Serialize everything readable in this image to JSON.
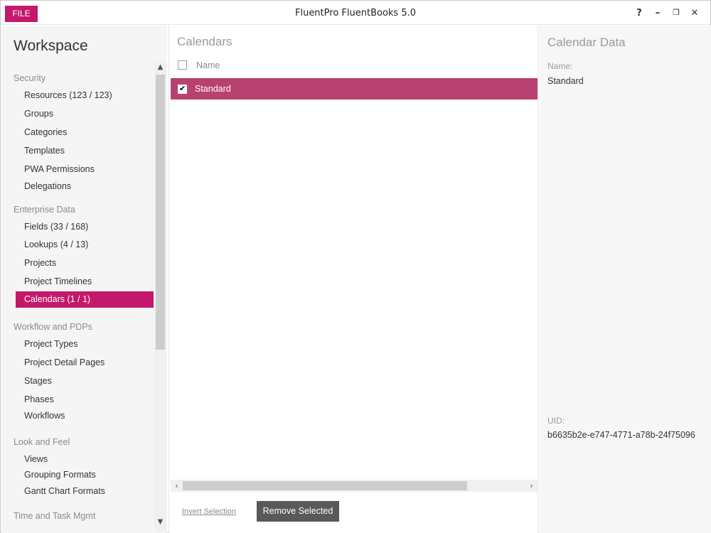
{
  "titlebar": {
    "file_label": "FILE",
    "title": "FluentPro FluentBooks 5.0",
    "help": "?",
    "minimize": "–",
    "restore": "❐",
    "close": "✕"
  },
  "sidebar": {
    "title": "Workspace",
    "sections": [
      {
        "label": "Security",
        "items": [
          "Resources (123 / 123)",
          "Groups",
          "Categories",
          "Templates",
          "PWA Permissions",
          "Delegations"
        ]
      },
      {
        "label": "Enterprise Data",
        "items": [
          "Fields (33 / 168)",
          "Lookups (4 / 13)",
          "Projects",
          "Project Timelines",
          "Calendars (1 / 1)"
        ]
      },
      {
        "label": "Workflow and PDPs",
        "items": [
          "Project Types",
          "Project Detail Pages",
          "Stages",
          "Phases",
          "Workflows"
        ]
      },
      {
        "label": "Look and Feel",
        "items": [
          "Views",
          "Grouping Formats",
          "Gantt Chart Formats"
        ]
      },
      {
        "label": "Time and Task Mgmt",
        "items": []
      }
    ],
    "selected_item": "Calendars (1 / 1)",
    "scroll_up": "▲",
    "scroll_down": "▼"
  },
  "calendars": {
    "title": "Calendars",
    "column_name": "Name",
    "rows": [
      {
        "name": "Standard",
        "checked": true
      }
    ],
    "invert_selection": "Invert Selection",
    "remove_selected": "Remove Selected",
    "scroll_left": "‹",
    "scroll_right": "›"
  },
  "calendar_data": {
    "title": "Calendar Data",
    "name_label": "Name:",
    "name_value": "Standard",
    "uid_label": "UID:",
    "uid_value": "b6635b2e-e747-4771-a78b-24f75096"
  },
  "colors": {
    "accent": "#c4186b",
    "selected_row": "#b9416f",
    "button_dark": "#595959"
  }
}
